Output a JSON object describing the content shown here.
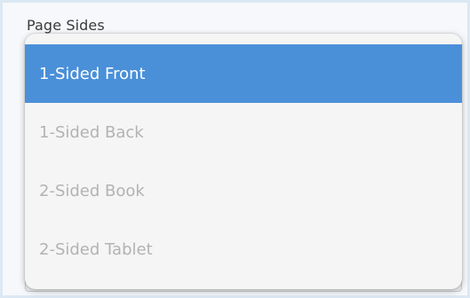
{
  "field": {
    "label": "Page Sides"
  },
  "dropdown": {
    "options": [
      {
        "label": "1-Sided Front",
        "selected": true
      },
      {
        "label": "1-Sided Back",
        "selected": false
      },
      {
        "label": "2-Sided Book",
        "selected": false
      },
      {
        "label": "2-Sided Tablet",
        "selected": false
      }
    ]
  },
  "colors": {
    "selected_bg": "#4a90d9",
    "selected_text": "#ffffff",
    "option_text": "#b3b3b3",
    "menu_bg": "#f5f5f5"
  }
}
